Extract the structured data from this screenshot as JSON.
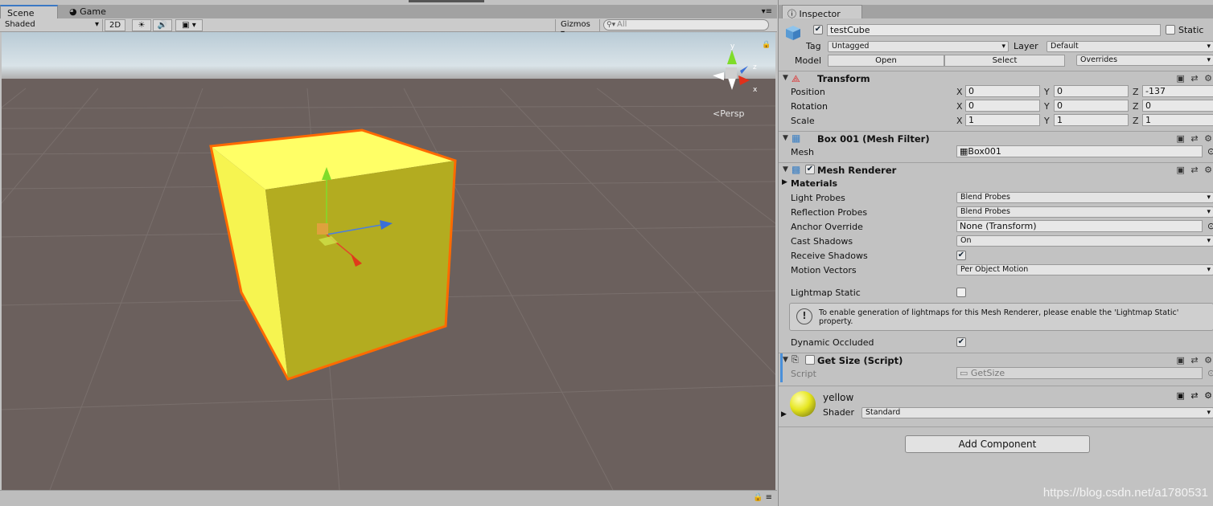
{
  "scene": {
    "tabs": [
      {
        "label": "Scene",
        "active": true
      },
      {
        "label": "Game",
        "active": false
      }
    ],
    "shading_mode": "Shaded",
    "mode_2d": "2D",
    "gizmos_label": "Gizmos",
    "search_placeholder": "All",
    "view_label": "Persp",
    "gizmo_axes": [
      "y",
      "z",
      "x"
    ],
    "selected_object_color": "#f0f03c",
    "outline_color": "#ff6a00"
  },
  "inspector": {
    "tab_label": "Inspector",
    "object_name": "testCube",
    "static_label": "Static",
    "tag_label": "Tag",
    "tag_value": "Untagged",
    "layer_label": "Layer",
    "layer_value": "Default",
    "model_label": "Model",
    "model_open": "Open",
    "model_select": "Select",
    "model_overrides": "Overrides",
    "transform": {
      "title": "Transform",
      "rows": [
        {
          "label": "Position",
          "x": "0",
          "y": "0",
          "z": "-137"
        },
        {
          "label": "Rotation",
          "x": "0",
          "y": "0",
          "z": "0"
        },
        {
          "label": "Scale",
          "x": "1",
          "y": "1",
          "z": "1"
        }
      ]
    },
    "mesh_filter": {
      "title": "Box 001 (Mesh Filter)",
      "mesh_label": "Mesh",
      "mesh_value": "Box001"
    },
    "mesh_renderer": {
      "title": "Mesh Renderer",
      "materials_label": "Materials",
      "light_probes_label": "Light Probes",
      "light_probes_value": "Blend Probes",
      "reflection_probes_label": "Reflection Probes",
      "reflection_probes_value": "Blend Probes",
      "anchor_override_label": "Anchor Override",
      "anchor_override_value": "None (Transform)",
      "cast_shadows_label": "Cast Shadows",
      "cast_shadows_value": "On",
      "receive_shadows_label": "Receive Shadows",
      "motion_vectors_label": "Motion Vectors",
      "motion_vectors_value": "Per Object Motion",
      "lightmap_static_label": "Lightmap Static",
      "help_text": "To enable generation of lightmaps for this Mesh Renderer, please enable the 'Lightmap Static' property.",
      "dynamic_occluded_label": "Dynamic Occluded"
    },
    "get_size": {
      "title": "Get Size (Script)",
      "script_label": "Script",
      "script_value": "GetSize"
    },
    "material": {
      "name": "yellow",
      "shader_label": "Shader",
      "shader_value": "Standard"
    },
    "add_component": "Add Component"
  },
  "watermark": "https://blog.csdn.net/a1780531"
}
